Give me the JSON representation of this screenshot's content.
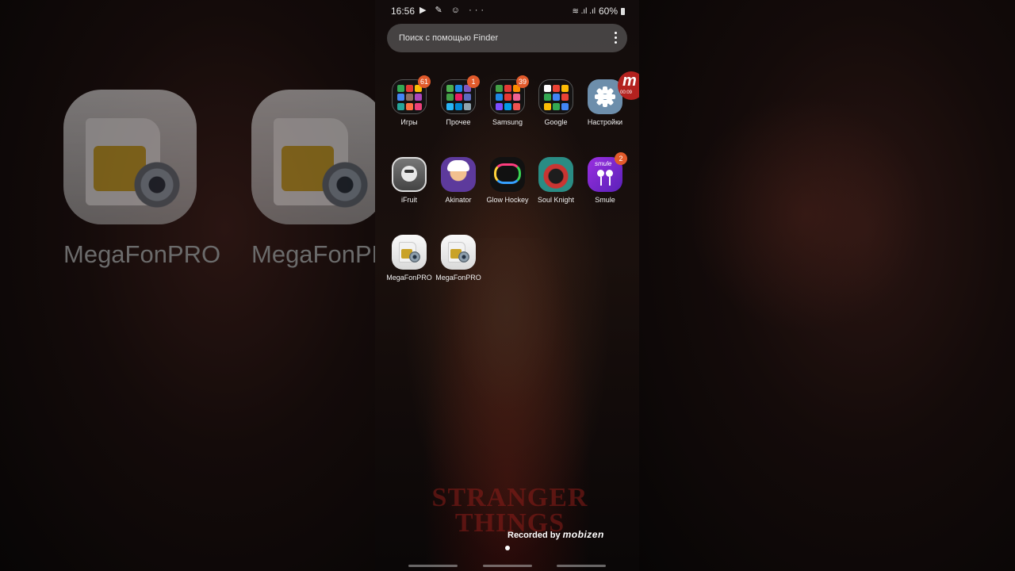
{
  "status_bar": {
    "time": "16:56",
    "left_icons": [
      "youtube-icon",
      "mic-icon",
      "smile-icon",
      "more-dots-icon"
    ],
    "left_icons_text": "▶ ✎ ☺ ···",
    "battery": "60%",
    "right_icons_text": "≋ .ıl .ıl"
  },
  "search": {
    "placeholder": "Поиск с помощью Finder"
  },
  "apps_row1": [
    {
      "label": "Игры",
      "badge": "61",
      "type": "folder"
    },
    {
      "label": "Прочее",
      "badge": "1",
      "type": "folder"
    },
    {
      "label": "Samsung",
      "badge": "39",
      "type": "folder"
    },
    {
      "label": "Google",
      "badge": "",
      "type": "folder"
    },
    {
      "label": "Настройки",
      "badge": "",
      "type": "settings"
    }
  ],
  "apps_row2": [
    {
      "label": "iFruit",
      "badge": ""
    },
    {
      "label": "Akinator",
      "badge": ""
    },
    {
      "label": "Glow Hockey",
      "badge": ""
    },
    {
      "label": "Soul Knight",
      "badge": ""
    },
    {
      "label": "Smule",
      "badge": "2"
    }
  ],
  "apps_row3": [
    {
      "label": "MegaFonPRO"
    },
    {
      "label": "MegaFonPRO"
    }
  ],
  "smule_icon_text": "smule",
  "floating_bubble": {
    "letter": "m",
    "time": "00:09"
  },
  "watermark": {
    "line1": "STRANGER",
    "line2": "THINGS"
  },
  "recorder": {
    "prefix": "Recorded by",
    "brand": "mobizen"
  },
  "background_blur_labels": [
    "MegaFonPRO",
    "MegaFonPRO"
  ],
  "colors": {
    "badge": "#e15a2b",
    "settings": "#6d8eab",
    "smule": "#9a2fe0",
    "bubble": "#b3221f"
  }
}
